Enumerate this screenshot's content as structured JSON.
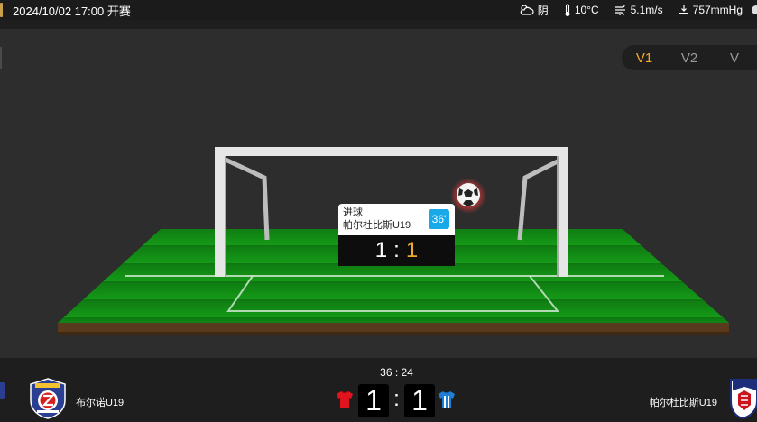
{
  "header": {
    "kickoff": "2024/10/02 17:00 开赛",
    "weather": {
      "condition": "阴",
      "temperature": "10°C",
      "wind": "5.1m/s",
      "pressure": "757mmHg"
    }
  },
  "view_tabs": [
    {
      "label": "V1",
      "active": true
    },
    {
      "label": "V2",
      "active": false
    },
    {
      "label": "V",
      "active": false
    }
  ],
  "event": {
    "type": "进球",
    "team": "帕尔杜比斯U19",
    "minute": "36'",
    "score_home": "1",
    "score_sep": ":",
    "score_away": "1"
  },
  "scoreboard": {
    "match_clock": "36 : 24",
    "home_team": "布尔诺U19",
    "away_team": "帕尔杜比斯U19",
    "home_score": "1",
    "separator": ":",
    "away_score": "1"
  },
  "colors": {
    "accent": "#f0a929",
    "minute_badge": "#19a8e8",
    "home_kit": "#e0141e",
    "away_kit": "#1e7fd6",
    "pitch": "#1b8a1b"
  },
  "icons": [
    "cloudy-weather-icon",
    "thermometer-icon",
    "wind-icon",
    "pressure-icon",
    "football-icon",
    "home-jersey-icon",
    "away-jersey-icon"
  ]
}
